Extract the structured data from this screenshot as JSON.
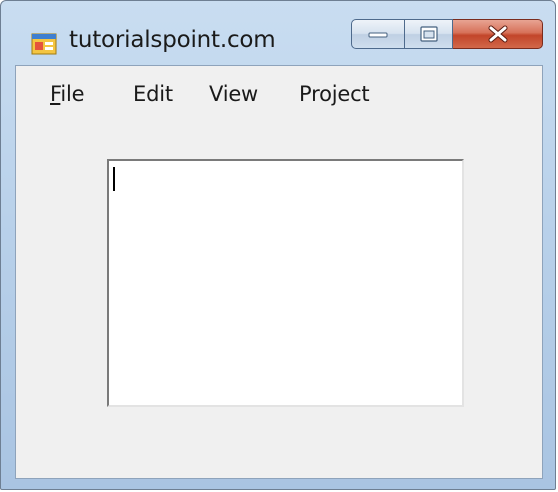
{
  "window": {
    "title": "tutorialspoint.com",
    "icon": "form-app-icon",
    "controls": {
      "minimize_icon": "minimize-icon",
      "maximize_icon": "maximize-icon",
      "close_icon": "close-icon"
    }
  },
  "menu": {
    "items": [
      {
        "label_first": "F",
        "label_rest": "ile"
      },
      {
        "label": "Edit"
      },
      {
        "label": "View"
      },
      {
        "label": "Project"
      }
    ]
  },
  "textbox": {
    "value": ""
  },
  "colors": {
    "frame": "#b9d1ea",
    "client": "#f0f0f0",
    "close_button": "#c2452a"
  }
}
